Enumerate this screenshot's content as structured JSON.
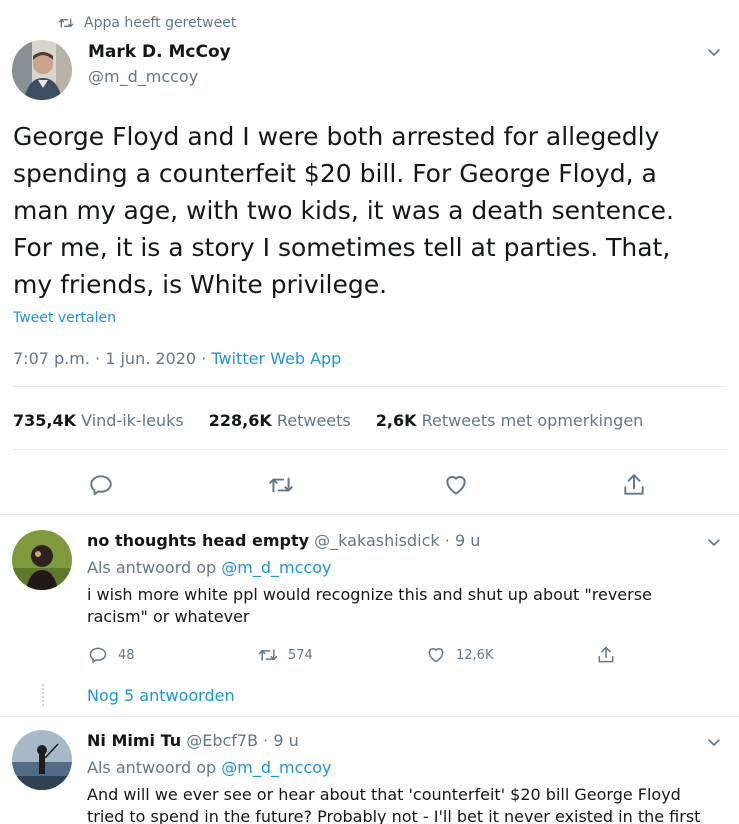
{
  "retweet_context": {
    "text": "Appa heeft geretweet",
    "icon": "retweet-icon"
  },
  "main_tweet": {
    "author_name": "Mark D. McCoy",
    "author_handle": "@m_d_mccoy",
    "text": "George Floyd and I were both arrested for allegedly spending a counterfeit $20 bill. For George Floyd, a man my age, with two kids, it was a death sentence. For me, it is a story I sometimes tell at parties. That, my friends, is White privilege.",
    "translate_label": "Tweet vertalen",
    "time": "7:07 p.m.",
    "date": "1 jun. 2020",
    "source": "Twitter Web App",
    "separator": "·",
    "stats": {
      "likes_count": "735,4K",
      "likes_label": "Vind-ik-leuks",
      "retweets_count": "228,6K",
      "retweets_label": "Retweets",
      "quotes_count": "2,6K",
      "quotes_label": "Retweets met opmerkingen"
    }
  },
  "replies": [
    {
      "author_name": "no thoughts head empty",
      "author_handle": "@_kakashisdick",
      "age": "9 u",
      "reply_to_prefix": "Als antwoord op",
      "reply_to_handle": "@m_d_mccoy",
      "text": "i wish more white ppl would recognize this and shut up about \"reverse racism\" or whatever",
      "reply_count": "48",
      "retweet_count": "574",
      "like_count": "12,6K"
    },
    {
      "author_name": "Ni Mimi Tu",
      "author_handle": "@Ebcf7B",
      "age": "9 u",
      "reply_to_prefix": "Als antwoord op",
      "reply_to_handle": "@m_d_mccoy",
      "text": "And will we ever see or hear about that 'counterfeit' $20 bill George Floyd tried to spend in the future? Probably not - I'll bet it never existed in the first"
    }
  ],
  "more_replies_label": "Nog 5 antwoorden",
  "colors": {
    "link": "#1b95e0",
    "secondary": "#657786",
    "divider": "#e6ecf0",
    "text": "#14171a"
  }
}
